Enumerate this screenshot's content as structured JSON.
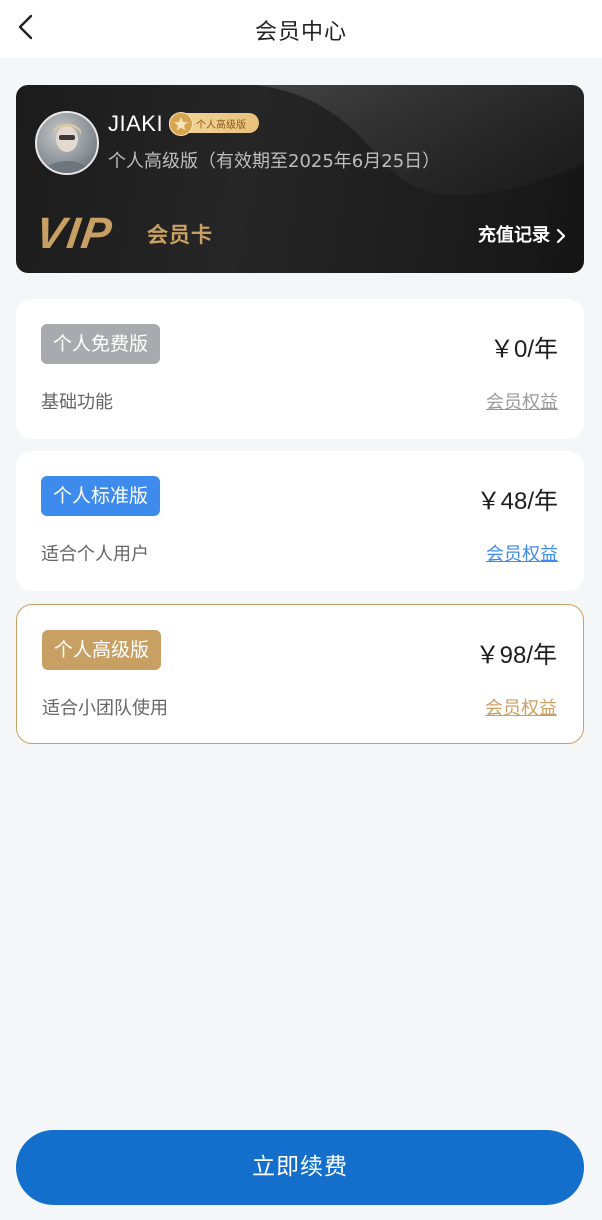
{
  "header": {
    "title": "会员中心",
    "back_icon": "chevron-left-icon"
  },
  "vip_card": {
    "user_name": "JIAKI",
    "level_tag": "个人高级版",
    "validity": "个人高级版（有效期至2025年6月25日）",
    "logo_text": "VIP",
    "card_label": "会员卡",
    "recharge_label": "充值记录",
    "accent_color": "#c9a063"
  },
  "plans": [
    {
      "badge": "个人免费版",
      "price": "￥0/年",
      "description": "基础功能",
      "link": "会员权益",
      "badge_color": "#a9aaad",
      "link_color": "#9a9a9a"
    },
    {
      "badge": "个人标准版",
      "price": "￥48/年",
      "description": "适合个人用户",
      "link": "会员权益",
      "badge_color": "#3d8bed",
      "link_color": "#3d8bed"
    },
    {
      "badge": "个人高级版",
      "price": "￥98/年",
      "description": "适合小团队使用",
      "link": "会员权益",
      "badge_color": "#c9a063",
      "link_color": "#c9a063",
      "selected": true
    }
  ],
  "footer": {
    "renew_label": "立即续费",
    "button_color": "#136fcb"
  }
}
